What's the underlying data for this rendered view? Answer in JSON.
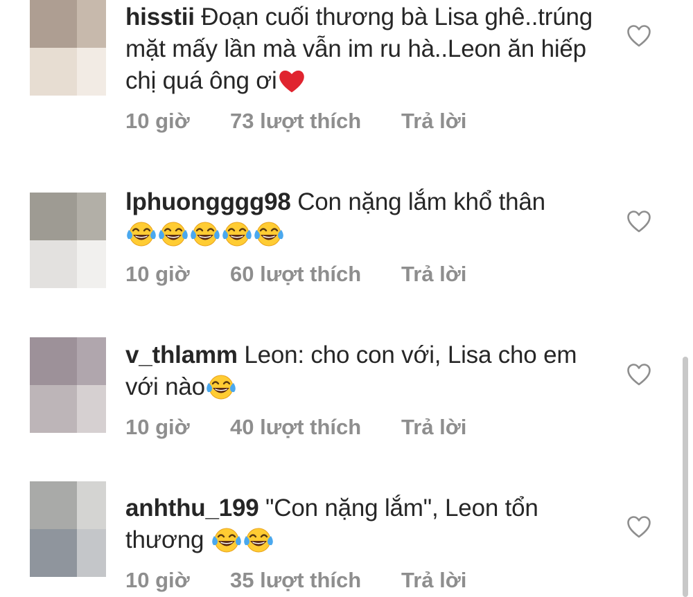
{
  "colors": {
    "text": "#262626",
    "meta": "#8e8e8e",
    "heart_outline": "#8e8e8e",
    "heart_emoji": "#e0242f",
    "scrollbar": "#c8c8c8"
  },
  "comments": [
    {
      "username": "hisstii",
      "text": " Đoạn cuối thương bà Lisa ghê..trúng mặt mấy lần mà vẫn im ru hà..Leon ăn hiếp chị quá ông ơi",
      "emoji": [
        "red-heart-emoji"
      ],
      "time": "10 giờ",
      "likes": "73 lượt thích",
      "reply": "Trả lời",
      "avatar_colors": [
        "#ae9e92",
        "#c7b9ac",
        "#e7ddd2",
        "#f2ebe4"
      ]
    },
    {
      "username": "lphuongggg98",
      "text": " Con nặng lắm khổ thân",
      "emoji": [
        "tears-of-joy-emoji",
        "tears-of-joy-emoji",
        "tears-of-joy-emoji",
        "tears-of-joy-emoji",
        "tears-of-joy-emoji"
      ],
      "time": "10 giờ",
      "likes": "60 lượt thích",
      "reply": "Trả lời",
      "avatar_colors": [
        "#9e9b93",
        "#b2afa7",
        "#e3e1df",
        "#f1f0ee"
      ]
    },
    {
      "username": "v_thlamm",
      "text": " Leon: cho con với, Lisa cho em với nào",
      "emoji": [
        "tears-of-joy-emoji"
      ],
      "time": "10 giờ",
      "likes": "40 lượt thích",
      "reply": "Trả lời",
      "avatar_colors": [
        "#9d9199",
        "#b0a6ad",
        "#bdb5b8",
        "#d6d0d1"
      ]
    },
    {
      "username": "anhthu_199",
      "text": " \"Con nặng lắm\", Leon tổn thương ",
      "emoji": [
        "tears-of-joy-emoji",
        "tears-of-joy-emoji"
      ],
      "time": "10 giờ",
      "likes": "35 lượt thích",
      "reply": "Trả lời",
      "avatar_colors": [
        "#a9aaa8",
        "#d4d4d2",
        "#8f959d",
        "#c4c6c9"
      ]
    }
  ]
}
